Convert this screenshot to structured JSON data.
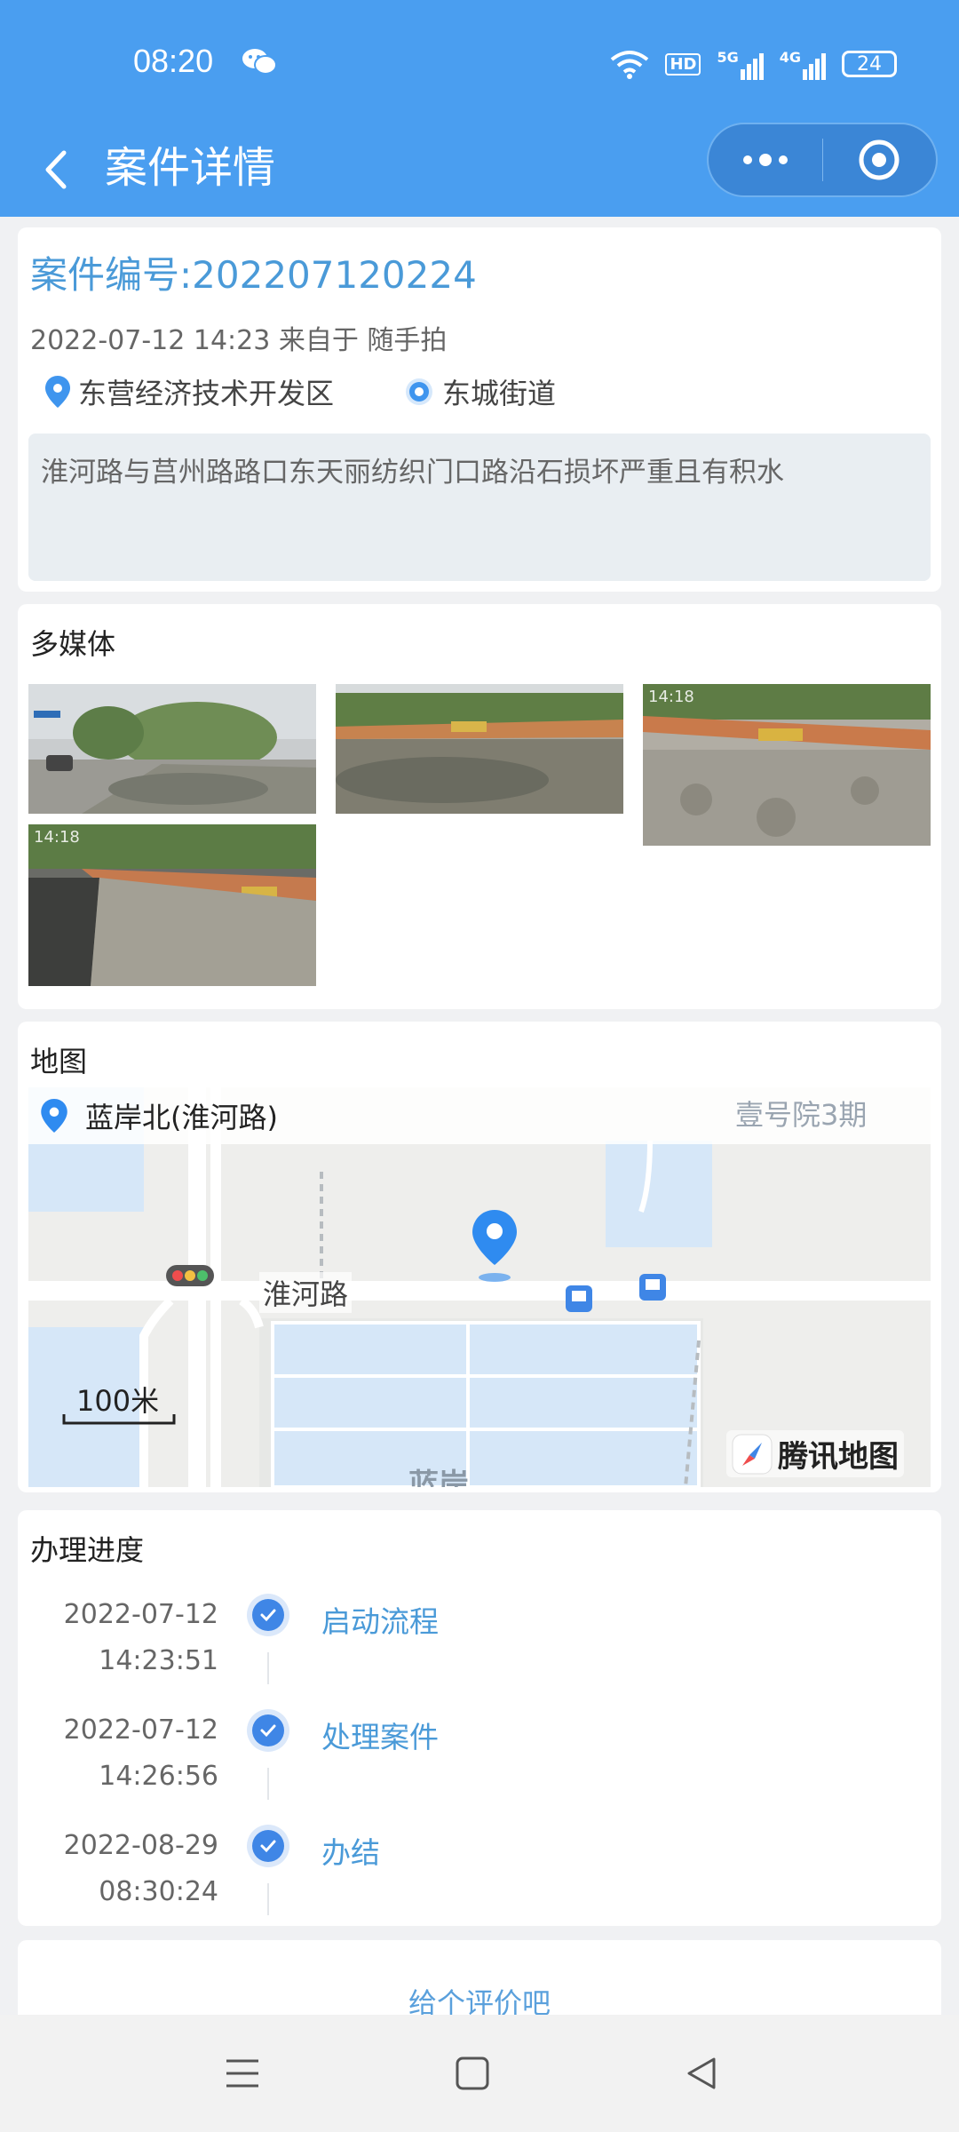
{
  "status": {
    "time": "08:20",
    "network_5g": "5G",
    "network_4g": "4G",
    "battery": "24",
    "hd": "HD"
  },
  "nav": {
    "title": "案件详情",
    "back_icon": "chevron-left-icon",
    "more_icon": "more-dots-icon",
    "close_icon": "target-close-icon"
  },
  "case": {
    "number_label": "案件编号:202207120224",
    "meta": "2022-07-12 14:23 来自于 随手拍",
    "district": "东营经济技术开发区",
    "street": "东城街道",
    "description": "淮河路与莒州路路口东天丽纺织门口路沿石损坏严重且有积水"
  },
  "media": {
    "title": "多媒体",
    "photos": [
      {
        "alt": "road-flood-1",
        "stamp": ""
      },
      {
        "alt": "road-flood-2",
        "stamp": ""
      },
      {
        "alt": "curb-damage-3",
        "stamp": "14:18"
      },
      {
        "alt": "curb-damage-4",
        "stamp": "14:18"
      }
    ]
  },
  "map": {
    "title": "地图",
    "location_name": "蓝岸北(淮河路)",
    "road_label": "淮河路",
    "poi_label": "壹号院3期",
    "area_label": "蓝岸",
    "scale_label": "100米",
    "logo_text": "腾讯地图",
    "colors": {
      "road": "#ffffff",
      "water": "#d6e7f8",
      "land": "#eeeeec",
      "pin": "#2f8bf0"
    }
  },
  "progress": {
    "title": "办理进度",
    "steps": [
      {
        "date": "2022-07-12",
        "time": "14:23:51",
        "label": "启动流程"
      },
      {
        "date": "2022-07-12",
        "time": "14:26:56",
        "label": "处理案件"
      },
      {
        "date": "2022-08-29",
        "time": "08:30:24",
        "label": "办结"
      }
    ]
  },
  "rating": {
    "label": "给个评价吧"
  },
  "system_nav": {
    "menu_icon": "menu-icon",
    "home_icon": "home-square-icon",
    "back_icon": "back-triangle-icon"
  }
}
